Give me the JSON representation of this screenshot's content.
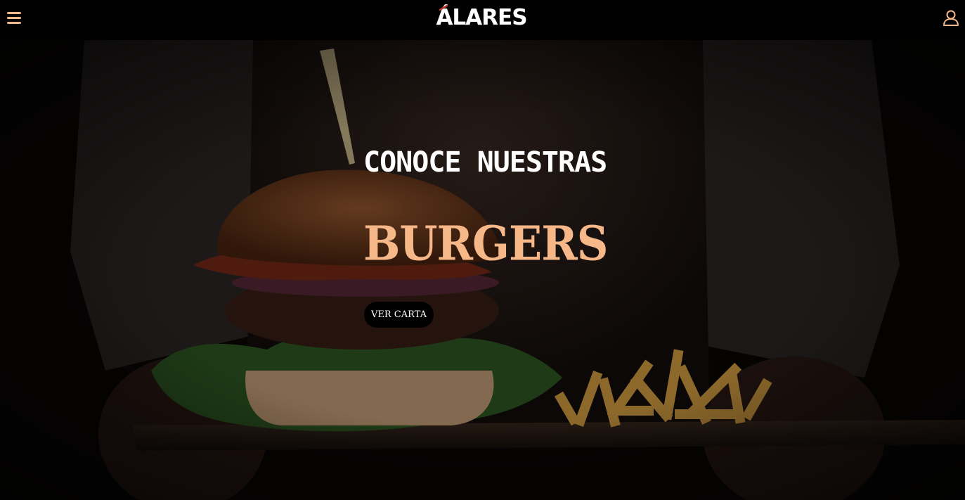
{
  "header": {
    "logo_text": "ÁLARES",
    "menu_icon": "hamburger-menu-icon",
    "user_icon": "user-account-icon",
    "accent_color": "#f3b78a"
  },
  "hero": {
    "headline": "CONOCE NUESTRAS",
    "subheadline": "BURGERS",
    "cta_label": "VER CARTA",
    "headline_color": "#ffffff",
    "subheadline_color": "#f6b889",
    "background_image": "burger-and-fries-on-wooden-board-photo"
  }
}
